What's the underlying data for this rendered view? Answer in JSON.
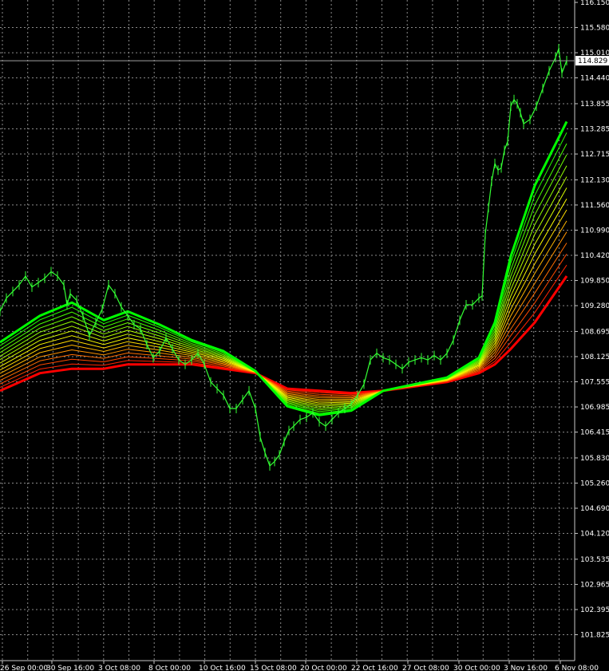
{
  "chart_data": {
    "type": "line",
    "title": "",
    "xlabel": "",
    "ylabel": "",
    "ylim": [
      101.545,
      116.15
    ],
    "grid": true,
    "colors": {
      "background": "#000000",
      "grid": "#8a8a8a",
      "price": "#33ff33",
      "current_price_line": "#a0a0a0",
      "ribbon_fast": "#00ff00",
      "ribbon_mid": "#ffff00",
      "ribbon_slow": "#ff0000"
    },
    "current_price": "114.829",
    "y_ticks": [
      "116.150",
      "115.580",
      "115.010",
      "114.440",
      "113.855",
      "113.285",
      "112.715",
      "112.130",
      "111.560",
      "110.990",
      "110.420",
      "109.850",
      "109.280",
      "108.695",
      "108.125",
      "107.555",
      "106.985",
      "106.415",
      "105.830",
      "105.260",
      "104.690",
      "104.120",
      "103.535",
      "102.965",
      "102.395",
      "101.825"
    ],
    "x_ticks": [
      "26 Sep 00:00",
      "30 Sep 16:00",
      "3 Oct 08:00",
      "8 Oct 00:00",
      "10 Oct 16:00",
      "15 Oct 08:00",
      "20 Oct 00:00",
      "22 Oct 16:00",
      "27 Oct 08:00",
      "30 Oct 00:00",
      "3 Nov 16:00",
      "6 Nov 08:00"
    ],
    "price_series": {
      "name": "",
      "x": [
        0,
        8,
        16,
        24,
        32,
        40,
        48,
        56,
        64,
        72,
        80,
        84,
        88,
        96,
        104,
        112,
        120,
        128,
        136,
        144,
        152,
        160,
        168,
        176,
        184,
        192,
        200,
        208,
        216,
        224,
        232,
        240,
        248,
        256,
        264,
        272,
        280,
        288,
        296,
        304,
        312,
        320,
        326,
        332,
        338,
        344,
        350,
        356,
        362,
        368,
        376,
        384,
        392,
        400,
        408,
        416,
        424,
        432,
        440,
        448,
        456,
        464,
        472,
        480,
        488,
        496,
        504,
        512,
        520,
        528,
        536,
        544,
        552,
        560,
        568,
        576,
        584,
        592,
        600,
        604,
        608,
        612,
        616,
        620,
        624,
        628,
        632,
        636,
        640,
        644,
        648,
        652,
        656,
        664,
        672,
        680,
        688,
        696,
        700,
        704,
        710
      ],
      "y": [
        109.15,
        109.45,
        109.6,
        109.75,
        109.95,
        109.7,
        109.8,
        109.9,
        110.05,
        109.95,
        109.75,
        109.3,
        109.55,
        109.4,
        109.05,
        108.6,
        108.9,
        109.2,
        109.75,
        109.55,
        109.25,
        109.05,
        108.85,
        108.75,
        108.4,
        108.1,
        108.25,
        108.55,
        108.3,
        108.05,
        107.95,
        108.05,
        108.2,
        107.95,
        107.55,
        107.4,
        107.25,
        106.95,
        106.95,
        107.15,
        107.35,
        106.95,
        106.3,
        105.95,
        105.65,
        105.75,
        105.9,
        106.2,
        106.45,
        106.55,
        106.7,
        106.75,
        106.85,
        106.65,
        106.55,
        106.7,
        106.85,
        106.95,
        107.05,
        107.25,
        107.5,
        108.05,
        108.2,
        108.1,
        108.05,
        107.95,
        107.85,
        108.0,
        108.05,
        108.1,
        108.05,
        108.15,
        108.05,
        108.2,
        108.5,
        108.95,
        109.3,
        109.3,
        109.45,
        109.5,
        110.9,
        111.5,
        112.1,
        112.5,
        112.35,
        112.4,
        112.8,
        113.0,
        113.8,
        113.95,
        113.85,
        113.65,
        113.4,
        113.5,
        113.8,
        114.2,
        114.6,
        114.9,
        115.1,
        114.55,
        114.83
      ]
    },
    "ribbon": {
      "x": [
        0,
        50,
        90,
        130,
        160,
        200,
        240,
        280,
        320,
        360,
        400,
        440,
        480,
        520,
        560,
        600,
        620,
        640,
        670,
        710
      ],
      "fast": [
        108.45,
        109.05,
        109.35,
        108.95,
        109.15,
        108.85,
        108.5,
        108.25,
        107.8,
        107.0,
        106.8,
        106.9,
        107.35,
        107.5,
        107.65,
        108.1,
        108.9,
        110.4,
        112.0,
        113.45
      ],
      "slow": [
        107.35,
        107.75,
        107.85,
        107.85,
        107.95,
        107.95,
        107.95,
        107.85,
        107.75,
        107.4,
        107.35,
        107.3,
        107.35,
        107.45,
        107.55,
        107.75,
        107.95,
        108.3,
        108.9,
        109.95
      ],
      "count": 15
    }
  }
}
